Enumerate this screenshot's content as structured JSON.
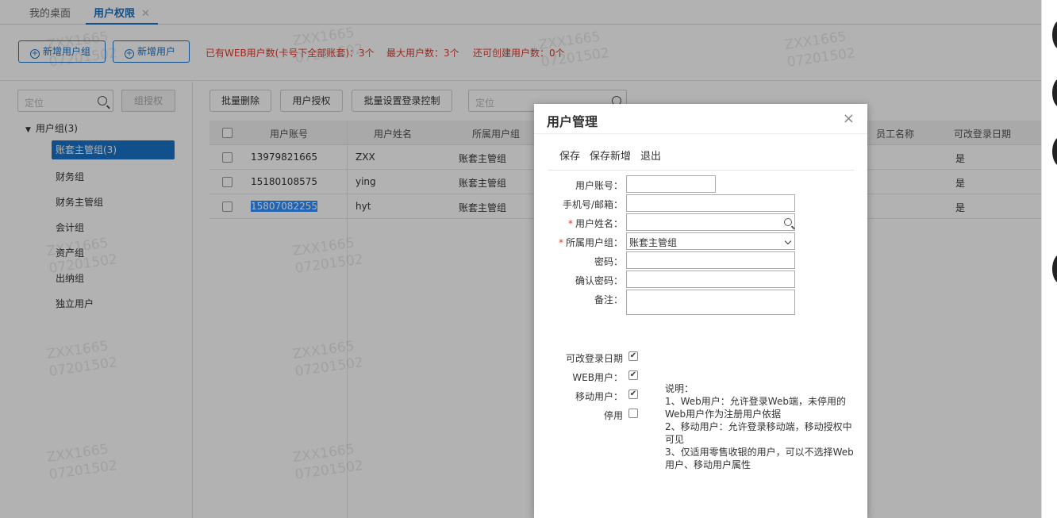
{
  "tabs": [
    {
      "label": "我的桌面"
    },
    {
      "label": "用户权限",
      "close": "✕"
    }
  ],
  "toolbar": {
    "add_group": "新增用户组",
    "add_user": "新增用户",
    "notice_web": "已有WEB用户数(卡号下全部账套)：3个",
    "notice_max": "最大用户数：3个",
    "notice_remain": "还可创建用户数：0个"
  },
  "left": {
    "search_placeholder": "定位",
    "grant_label": "组授权",
    "root_label": "用户组(3)",
    "groups": [
      "账套主管组(3)",
      "财务组",
      "财务主管组",
      "会计组",
      "资产组",
      "出纳组",
      "独立用户"
    ]
  },
  "right_toolbar": {
    "batch_delete": "批量删除",
    "user_grant": "用户授权",
    "batch_login": "批量设置登录控制",
    "search_placeholder": "定位"
  },
  "table": {
    "headers": [
      "用户账号",
      "用户姓名",
      "所属用户组",
      "员工名称",
      "可改登录日期"
    ],
    "rows": [
      {
        "account": "13979821665",
        "name": "ZXX",
        "group": "账套主管组",
        "can_change": "是"
      },
      {
        "account": "15180108575",
        "name": "ying",
        "group": "账套主管组",
        "can_change": "是"
      },
      {
        "account": "15807082255",
        "name": "hyt",
        "group": "账套主管组",
        "can_change": "是"
      }
    ]
  },
  "watermark": {
    "line1": "ZXX1665",
    "line2": "07201502"
  },
  "modal": {
    "title": "用户管理",
    "close": "×",
    "actions": [
      "保存",
      "保存新增",
      "退出"
    ],
    "fields": {
      "account": "用户账号：",
      "phone": "手机号/邮箱：",
      "name": "用户姓名：",
      "group": "所属用户组：",
      "group_value": "账套主管组",
      "password": "密码：",
      "confirm": "确认密码：",
      "remark": "备注："
    },
    "checks": {
      "change_date": "可改登录日期",
      "web": "WEB用户：",
      "mobile": "移动用户：",
      "disabled": "停用"
    },
    "note": {
      "title": "说明：",
      "l1": "1、Web用户：允许登录Web端，未停用的Web用户作为注册用户依据",
      "l2": "2、移动用户：允许登录移动端，移动授权中可见",
      "l3": "3、仅适用零售收银的用户，可以不选择Web用户、移动用户属性"
    }
  }
}
